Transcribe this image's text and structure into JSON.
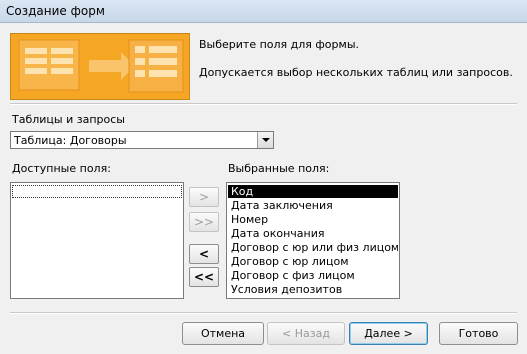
{
  "window": {
    "title": "Создание форм"
  },
  "header": {
    "line1": "Выберите поля для формы.",
    "line2": "Допускается выбор нескольких таблиц или запросов."
  },
  "tables_label": "Таблицы и запросы",
  "tables_combo_value": "Таблица: Договоры",
  "available_label": "Доступные поля:",
  "selected_label": "Выбранные поля:",
  "selected_fields": [
    "Код",
    "Дата заключения",
    "Номер",
    "Дата окончания",
    "Договор с юр или физ лицом",
    "Договор с юр лицом",
    "Договор с физ лицом",
    "Условия депозитов"
  ],
  "move_buttons": {
    "add_one": ">",
    "add_all": ">>",
    "remove_one": "<",
    "remove_all": "<<"
  },
  "footer": {
    "cancel": "Отмена",
    "back": "< Назад",
    "next": "Далее >",
    "finish": "Готово"
  },
  "colors": {
    "banner": "#f5a623",
    "selection": "#000000"
  },
  "icons": [
    "wizard-banner-graphic",
    "dropdown-arrow-icon"
  ]
}
